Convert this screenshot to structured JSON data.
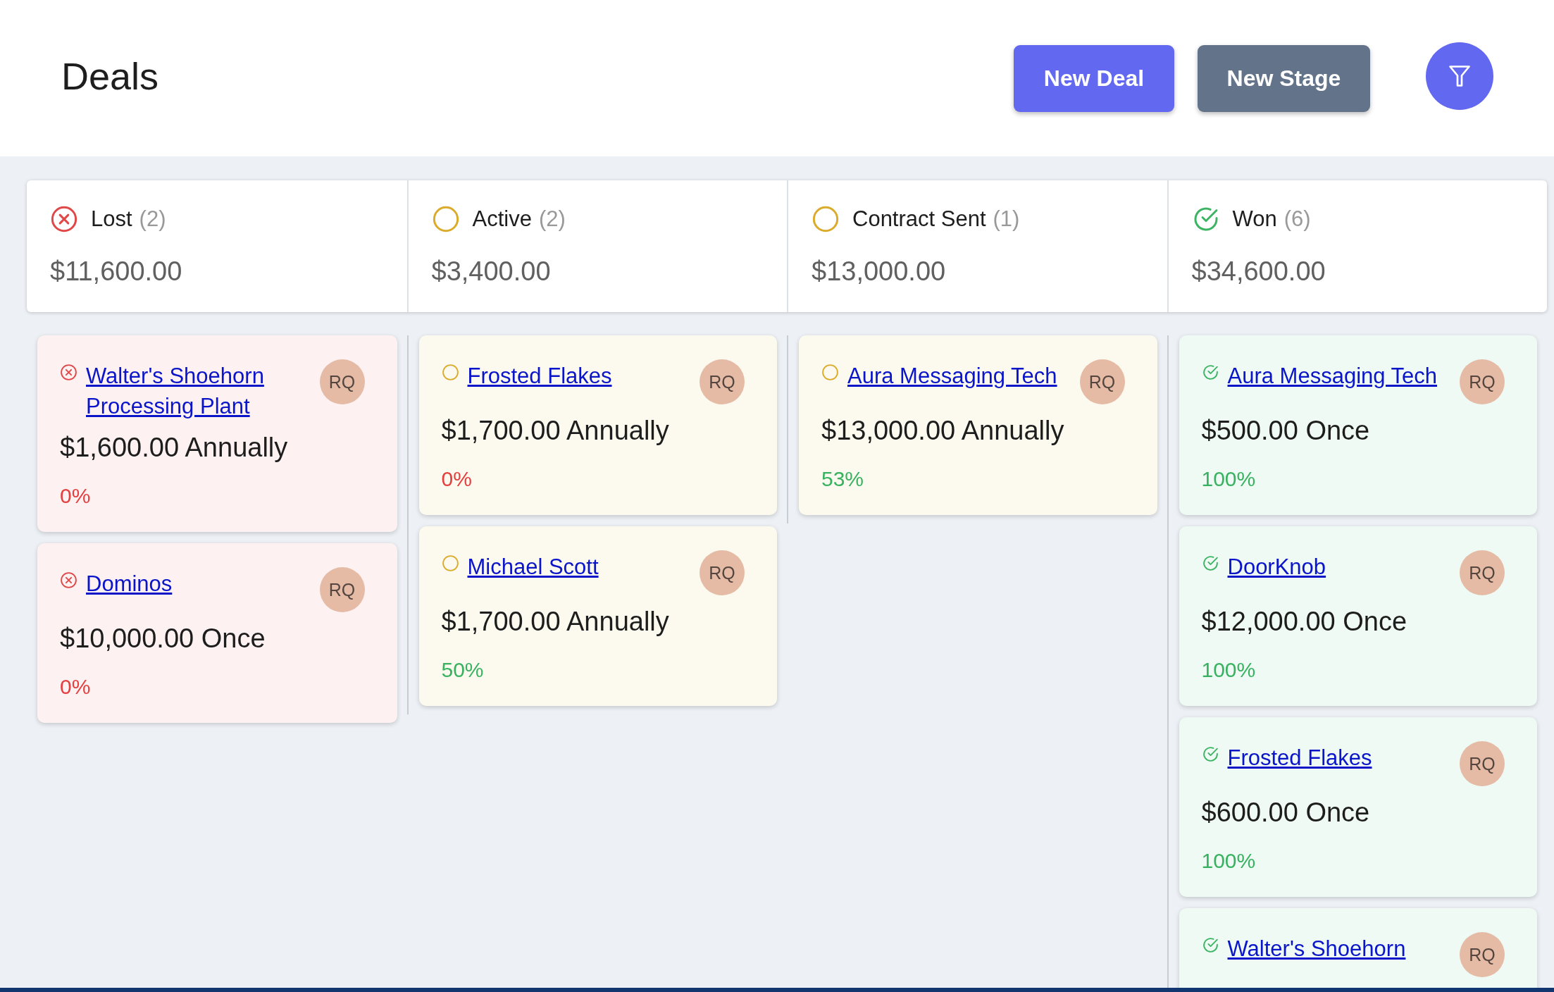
{
  "header": {
    "title": "Deals",
    "buttons": [
      {
        "label": "New Deal",
        "kind": "primary"
      },
      {
        "label": "New Stage",
        "kind": "secondary"
      }
    ]
  },
  "columns": [
    {
      "kind": "lost",
      "name": "Lost",
      "count": "(2)",
      "total": "$11,600.00",
      "deals": [
        {
          "title": "Walter's Shoehorn Processing Plant",
          "owner": "RQ",
          "amount": "$1,600.00 Annually",
          "percent": "0%",
          "color": "#e53e3e"
        },
        {
          "title": "Dominos",
          "owner": "RQ",
          "amount": "$10,000.00 Once",
          "percent": "0%",
          "color": "#e53e3e"
        }
      ]
    },
    {
      "kind": "active",
      "name": "Active",
      "count": "(2)",
      "total": "$3,400.00",
      "deals": [
        {
          "title": "Frosted Flakes",
          "owner": "RQ",
          "amount": "$1,700.00 Annually",
          "percent": "0%",
          "color": "#e53e3e"
        },
        {
          "title": "Michael Scott",
          "owner": "RQ",
          "amount": "$1,700.00 Annually",
          "percent": "50%",
          "color": "#38b260"
        }
      ]
    },
    {
      "kind": "active",
      "name": "Contract Sent",
      "count": "(1)",
      "total": "$13,000.00",
      "deals": [
        {
          "title": "Aura Messaging Tech",
          "owner": "RQ",
          "amount": "$13,000.00 Annually",
          "percent": "53%",
          "color": "#38b260"
        }
      ]
    },
    {
      "kind": "won",
      "name": "Won",
      "count": "(6)",
      "total": "$34,600.00",
      "deals": [
        {
          "title": "Aura Messaging Tech",
          "owner": "RQ",
          "amount": "$500.00 Once",
          "percent": "100%",
          "color": "#38b260"
        },
        {
          "title": "DoorKnob",
          "owner": "RQ",
          "amount": "$12,000.00 Once",
          "percent": "100%",
          "color": "#38b260"
        },
        {
          "title": "Frosted Flakes",
          "owner": "RQ",
          "amount": "$600.00 Once",
          "percent": "100%",
          "color": "#38b260"
        },
        {
          "title": "Walter's Shoehorn",
          "owner": "RQ"
        }
      ]
    }
  ]
}
